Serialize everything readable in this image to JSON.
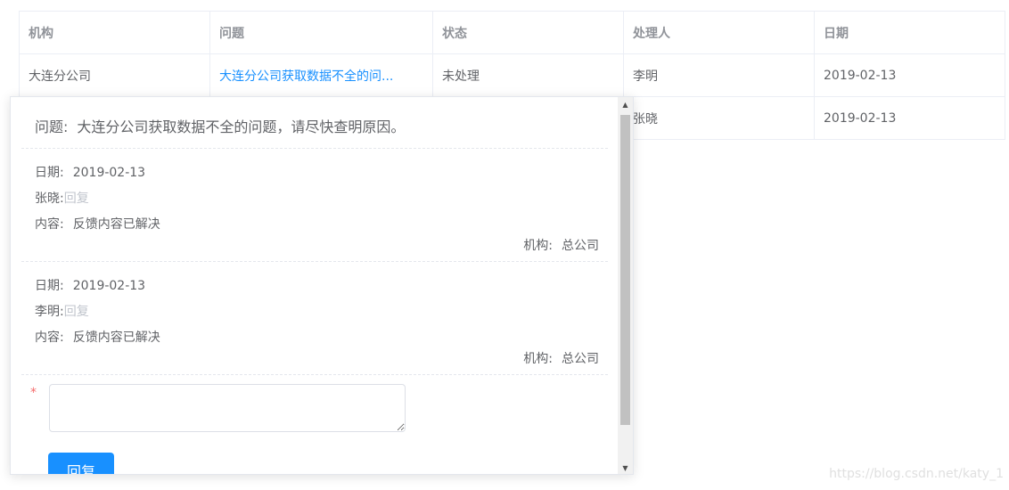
{
  "table": {
    "headers": [
      "机构",
      "问题",
      "状态",
      "处理人",
      "日期"
    ],
    "rows": [
      {
        "org": "大连分公司",
        "issue": "大连分公司获取数据不全的问...",
        "status": "未处理",
        "handler": "李明",
        "date": "2019-02-13"
      },
      {
        "org": "",
        "issue": "",
        "status": "",
        "handler": "张晓",
        "date": "2019-02-13"
      }
    ]
  },
  "popover": {
    "title_label": "问题:",
    "title_text": "大连分公司获取数据不全的问题，请尽快查明原因。",
    "replies": [
      {
        "date_label": "日期:",
        "date": "2019-02-13",
        "user": "张晓:",
        "reply_link": "回复",
        "content_label": "内容:",
        "content": "反馈内容已解决",
        "org_label": "机构:",
        "org": "总公司"
      },
      {
        "date_label": "日期:",
        "date": "2019-02-13",
        "user": "李明:",
        "reply_link": "回复",
        "content_label": "内容:",
        "content": "反馈内容已解决",
        "org_label": "机构:",
        "org": "总公司"
      }
    ],
    "required_mark": "*",
    "reply_input_value": "",
    "submit_label": "回复"
  },
  "scrollbar": {
    "up_glyph": "▲",
    "down_glyph": "▼",
    "scroll_fraction": 0.0
  },
  "watermark": "https://blog.csdn.net/katy_1",
  "colors": {
    "link": "#1890ff",
    "primary_button": "#1890ff",
    "required": "#f56c6c",
    "reply_link": "#c0c4cc"
  }
}
